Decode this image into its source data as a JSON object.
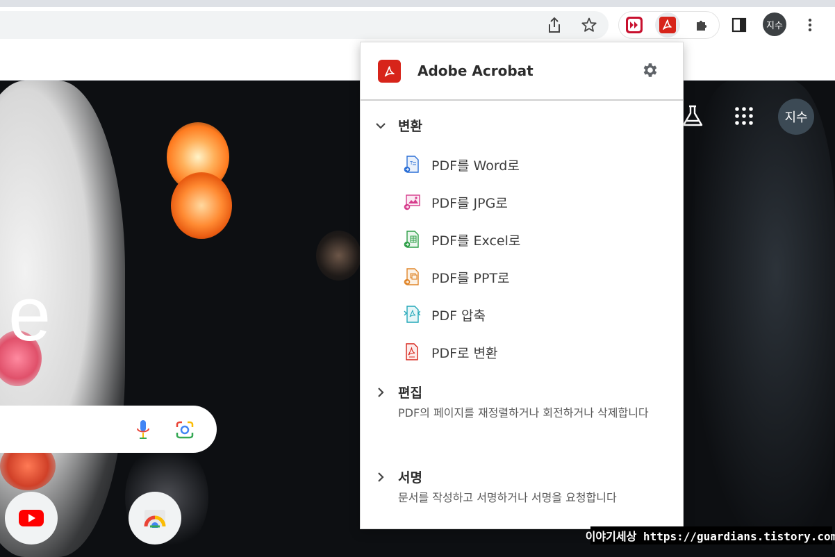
{
  "browser": {
    "profile_initials": "지수"
  },
  "page": {
    "logo_fragment": "e",
    "profile_initials": "지수"
  },
  "popup": {
    "title": "Adobe Acrobat",
    "sections": [
      {
        "label": "변환",
        "expanded": true,
        "items": [
          {
            "label": "PDF를 Word로",
            "icon": "pdf-to-word-icon",
            "color": "#2b6fd6"
          },
          {
            "label": "PDF를 JPG로",
            "icon": "pdf-to-jpg-icon",
            "color": "#d63c8c"
          },
          {
            "label": "PDF를 Excel로",
            "icon": "pdf-to-excel-icon",
            "color": "#2e9f48"
          },
          {
            "label": "PDF를 PPT로",
            "icon": "pdf-to-ppt-icon",
            "color": "#e0862a"
          },
          {
            "label": "PDF 압축",
            "icon": "pdf-compress-icon",
            "color": "#22a7b8"
          },
          {
            "label": "PDF로 변환",
            "icon": "convert-to-pdf-icon",
            "color": "#d7241a"
          }
        ]
      },
      {
        "label": "편집",
        "expanded": false,
        "description": "PDF의 페이지를 재정렬하거나 회전하거나 삭제합니다"
      },
      {
        "label": "서명",
        "expanded": false,
        "description": "문서를 작성하고 서명하거나 서명을 요청합니다"
      }
    ]
  },
  "watermark": "이야기세상 https://guardians.tistory.com",
  "colors": {
    "acrobat_red": "#d7241a",
    "chrome_bg": "#f1f3f4",
    "avatar_bg": "#3c4043"
  }
}
